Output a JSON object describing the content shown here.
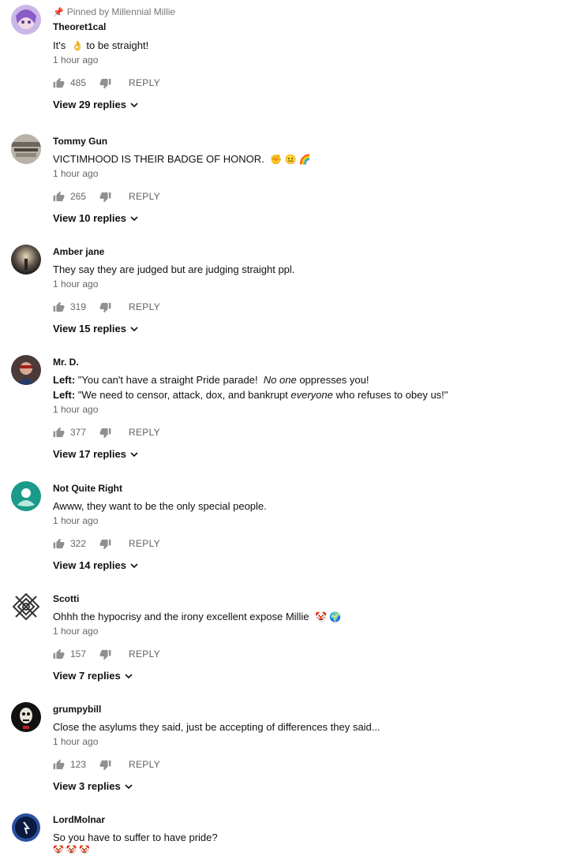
{
  "comments": [
    {
      "pinned": "Pinned by Millennial Millie",
      "author": "Theoret1cal",
      "text_before": "It's",
      "text_emoji": "👌",
      "text_after": " to be straight!",
      "time": "1 hour ago",
      "likes": "485",
      "reply": "REPLY",
      "replies": "View 29 replies"
    },
    {
      "author": "Tommy Gun",
      "text": "VICTIMHOOD IS THEIR BADGE OF HONOR.",
      "emoji": "✊ 😐 🌈",
      "time": "1 hour ago",
      "likes": "265",
      "reply": "REPLY",
      "replies": "View 10 replies"
    },
    {
      "author": "Amber jane",
      "text": "They say they are judged but are judging straight ppl.",
      "time": "1 hour ago",
      "likes": "319",
      "reply": "REPLY",
      "replies": "View 15 replies"
    },
    {
      "author": "Mr. D.",
      "line1_label": "Left:",
      "line1_a": " \"You can't have a straight Pride parade!  ",
      "line1_em": "No one",
      "line1_b": " oppresses you!",
      "line2_label": "Left:",
      "line2_a": " \"We need to censor, attack, dox, and bankrupt ",
      "line2_em": "everyone",
      "line2_b": " who refuses to obey us!\"",
      "time": "1 hour ago",
      "likes": "377",
      "reply": "REPLY",
      "replies": "View 17 replies"
    },
    {
      "author": "Not Quite Right",
      "text": "Awww, they want to be the only special people.",
      "time": "1 hour ago",
      "likes": "322",
      "reply": "REPLY",
      "replies": "View 14 replies"
    },
    {
      "author": "Scotti",
      "text": "Ohhh the hypocrisy and the irony excellent expose Millie",
      "emoji": "🤡 🌍",
      "time": "1 hour ago",
      "likes": "157",
      "reply": "REPLY",
      "replies": "View 7 replies"
    },
    {
      "author": "grumpybill",
      "text": "Close the asylums they said, just be accepting of differences they said...",
      "time": "1 hour ago",
      "likes": "123",
      "reply": "REPLY",
      "replies": "View 3 replies"
    },
    {
      "author": "LordMolnar",
      "text": "So you have to suffer to have pride?",
      "emoji": "🤡🤡🤡"
    }
  ]
}
